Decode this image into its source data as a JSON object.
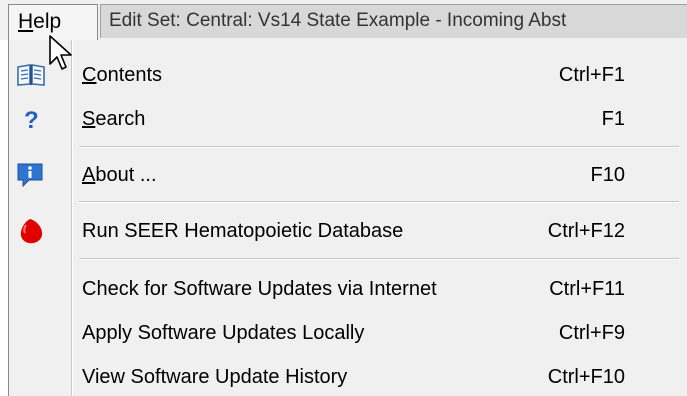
{
  "menubar": {
    "help_prefix": "",
    "help_underlined": "H",
    "help_rest": "elp",
    "window_title": "Edit Set: Central: Vs14 State Example - Incoming Abst"
  },
  "menu": {
    "items": [
      {
        "label_pre": "",
        "label_ul": "C",
        "label_post": "ontents",
        "shortcut": "Ctrl+F1",
        "icon": "book-icon"
      },
      {
        "label_pre": "",
        "label_ul": "S",
        "label_post": "earch",
        "shortcut": "F1",
        "icon": "question-icon"
      },
      {
        "label_pre": "",
        "label_ul": "A",
        "label_post": "bout ...",
        "shortcut": "F10",
        "icon": "info-icon"
      },
      {
        "label_pre": "Run SEER Hematopoietic Database",
        "label_ul": "",
        "label_post": "",
        "shortcut": "Ctrl+F12",
        "icon": "red-drop-icon"
      },
      {
        "label_pre": "Check for Software Updates via Internet",
        "label_ul": "",
        "label_post": "",
        "shortcut": "Ctrl+F11",
        "icon": ""
      },
      {
        "label_pre": "Apply Software Updates Locally",
        "label_ul": "",
        "label_post": "",
        "shortcut": "Ctrl+F9",
        "icon": ""
      },
      {
        "label_pre": "View Software Update History",
        "label_ul": "",
        "label_post": "",
        "shortcut": "Ctrl+F10",
        "icon": ""
      }
    ]
  },
  "colors": {
    "menu_background": "#f0f0f0",
    "separator": "#c6c6c6",
    "title_strip": "#d8d8d8",
    "drop_red": "#e00000",
    "question_blue": "#1f5fbf"
  }
}
